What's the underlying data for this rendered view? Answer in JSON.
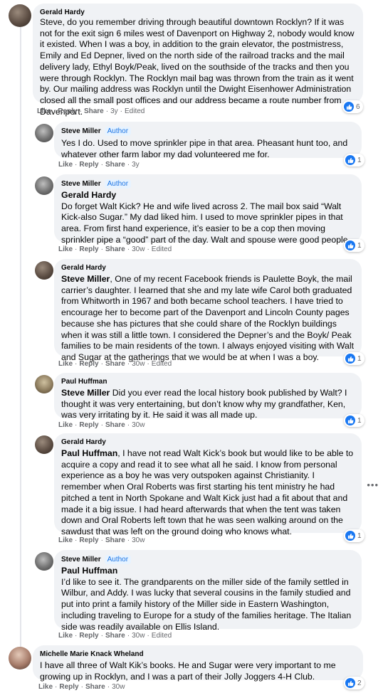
{
  "actions": {
    "like": "Like",
    "reply": "Reply",
    "share": "Share"
  },
  "author_badge": "Author",
  "colors": {
    "like_blue": "#1877f2",
    "bubble_bg": "#f0f2f5",
    "meta_gray": "#65676b",
    "badge_bg": "#e7f3ff",
    "badge_text": "#1b74e4"
  },
  "more_menu": "•••",
  "comments": [
    {
      "author": "Gerald Hardy",
      "text": "Steve, do you remember driving through beautiful downtown Rocklyn? If it was not for the exit sign 6 miles west of Davenport on Highway 2, nobody would know it existed. When I was a boy, in addition to the grain elevator, the postmistress, Emily and Ed Depner, lived on the north side of the railroad tracks and the mail delivery lady, Ethyl Boyk/Peak, lived on the southside of the tracks and then you were through Rocklyn. The Rocklyn mail bag was thrown from the train as it went by. Our mailing address was Rocklyn until the Dwight Eisenhower Administration closed all the small post offices and our address became a route number from Davenport.",
      "time": "3y",
      "edited": "Edited",
      "reactions": "6"
    },
    {
      "author": "Steve Miller",
      "text": "Yes I do. Used to move sprinkler pipe in that area. Pheasant hunt too, and whatever other farm labor my dad volunteered me for.",
      "time": "3y",
      "reactions": "1"
    },
    {
      "author": "Steve Miller",
      "mention": "Gerald Hardy",
      "text": "Do forget Walt Kick? He and wife lived across 2. The mail box said “Walt Kick-also Sugar.” My dad liked him. I used to move sprinkler pipes in that area. From first hand experience, it’s easier to be a cop then moving sprinkler pipe a “good” part of the day. Walt and spouse were good people.",
      "time": "30w",
      "edited": "Edited",
      "reactions": "1"
    },
    {
      "author": "Gerald Hardy",
      "mention": "Steve Miller",
      "text": ", One of my recent Facebook friends is Paulette Boyk, the mail carrier’s daughter. I learned that she and my late wife Carol both graduated from Whitworth in 1967 and both became school teachers. I have tried to encourage her to become part of the Davenport and Lincoln County pages because she has pictures that she could share of the Rocklyn buildings when it was still a little town. I considered the Depner’s and the Boyk/ Peak families to be main residents of the town. I always enjoyed visiting with Walt and Sugar at the gatherings that we would be at when I was a boy.",
      "time": "30w",
      "edited": "Edited",
      "reactions": "1"
    },
    {
      "author": "Paul Huffman",
      "mention": "Steve Miller",
      "text": " Did you ever read the local history book published by Walt? I thought it was very entertaining, but don’t know why my grandfather, Ken, was very irritating by it. He said it was all made up.",
      "time": "30w",
      "reactions": "1"
    },
    {
      "author": "Gerald Hardy",
      "mention": "Paul Huffman",
      "text": ", I have not read Walt Kick’s book but would like to be able to acquire a copy and read it to see what all he said. I know from personal experience as a boy he was very outspoken against Christianity. I remember when Oral Roberts was first starting his tent ministry he had pitched a tent in North Spokane and Walt Kick just had a fit about that and made it a big issue. I had heard afterwards that when the tent was taken down and Oral Roberts left town that he was seen walking around on the sawdust that was left on the ground doing who knows what.",
      "time": "30w",
      "reactions": "1"
    },
    {
      "author": "Steve Miller",
      "mention": "Paul Huffman",
      "text": "I’d like to see it. The grandparents on the miller side of the family settled in Wilbur, and Addy. I was lucky that several cousins in the family studied and put into print a family history of the Miller side in Eastern Washington, including traveling to Europe for a study of the families heritage. The Italian side was readily available on Ellis Island.",
      "time": "30w",
      "edited": "Edited"
    },
    {
      "author": "Michelle Marie Knack Wheland",
      "text": "I have all three of Walt Kik’s books. He and Sugar were very important to me growing up in Rocklyn, and I was a part of their Jolly Joggers 4-H Club.",
      "time": "30w",
      "reactions": "2"
    }
  ]
}
